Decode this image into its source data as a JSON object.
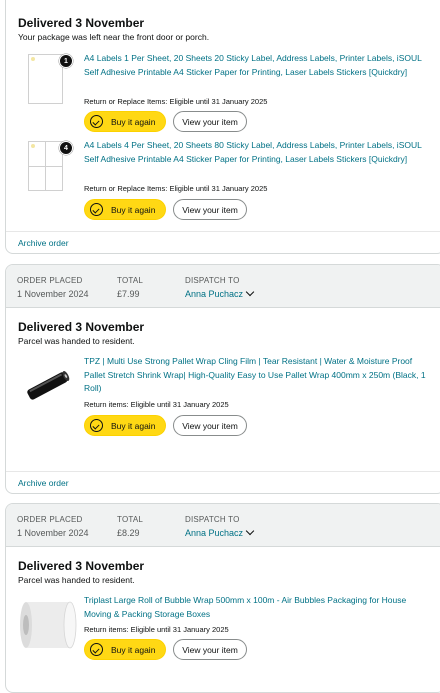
{
  "order1": {
    "delivery_title": "Delivered 3 November",
    "delivery_note": "Your package was left near the front door or porch.",
    "items": [
      {
        "title": "A4 Labels 1 Per Sheet, 20 Sheets 20 Sticky Label, Address Labels, Printer Labels, iSOUL Self Adhesive Printable A4 Sticker Paper for Printing, Laser Labels Stickers [Quickdry]",
        "quantity": "1",
        "eligibility": "Return or Replace Items: Eligible until 31 January 2025"
      },
      {
        "title": "A4 Labels 4 Per Sheet, 20 Sheets 80 Sticky Label, Address Labels, Printer Labels, iSOUL Self Adhesive Printable A4 Sticker Paper for Printing, Laser Labels Stickers [Quickdry]",
        "quantity": "4",
        "eligibility": "Return or Replace Items: Eligible until 31 January 2025"
      }
    ],
    "archive_label": "Archive order"
  },
  "order2": {
    "header": {
      "placed_label": "ORDER PLACED",
      "placed_value": "1 November 2024",
      "total_label": "TOTAL",
      "total_value": "£7.99",
      "dispatch_label": "DISPATCH TO",
      "dispatch_value": "Anna Puchacz"
    },
    "delivery_title": "Delivered 3 November",
    "delivery_note": "Parcel was handed to resident.",
    "item": {
      "title": "TPZ | Multi Use Strong Pallet Wrap Cling Film | Tear Resistant | Water & Moisture Proof Pallet Stretch Shrink Wrap| High-Quality Easy to Use Pallet Wrap 400mm x 250m (Black, 1 Roll)",
      "eligibility": "Return items: Eligible until 31 January 2025"
    },
    "archive_label": "Archive order"
  },
  "order3": {
    "header": {
      "placed_label": "ORDER PLACED",
      "placed_value": "1 November 2024",
      "total_label": "TOTAL",
      "total_value": "£8.29",
      "dispatch_label": "DISPATCH TO",
      "dispatch_value": "Anna Puchacz"
    },
    "delivery_title": "Delivered 3 November",
    "delivery_note": "Parcel was handed to resident.",
    "item": {
      "title": "Triplast Large Roll of Bubble Wrap 500mm x 100m - Air Bubbles Packaging for House Moving & Packing Storage Boxes",
      "eligibility": "Return items: Eligible until 31 January 2025"
    }
  },
  "buttons": {
    "buy_again": "Buy it again",
    "view_item": "View your item"
  },
  "colors": {
    "link": "#007185",
    "buy_button": "#ffd814",
    "header_bg": "#f0f2f2",
    "border": "#d5d9d9"
  },
  "icons": {
    "buy_again": "buy-again-icon",
    "dropdown": "chevron-down-icon"
  }
}
